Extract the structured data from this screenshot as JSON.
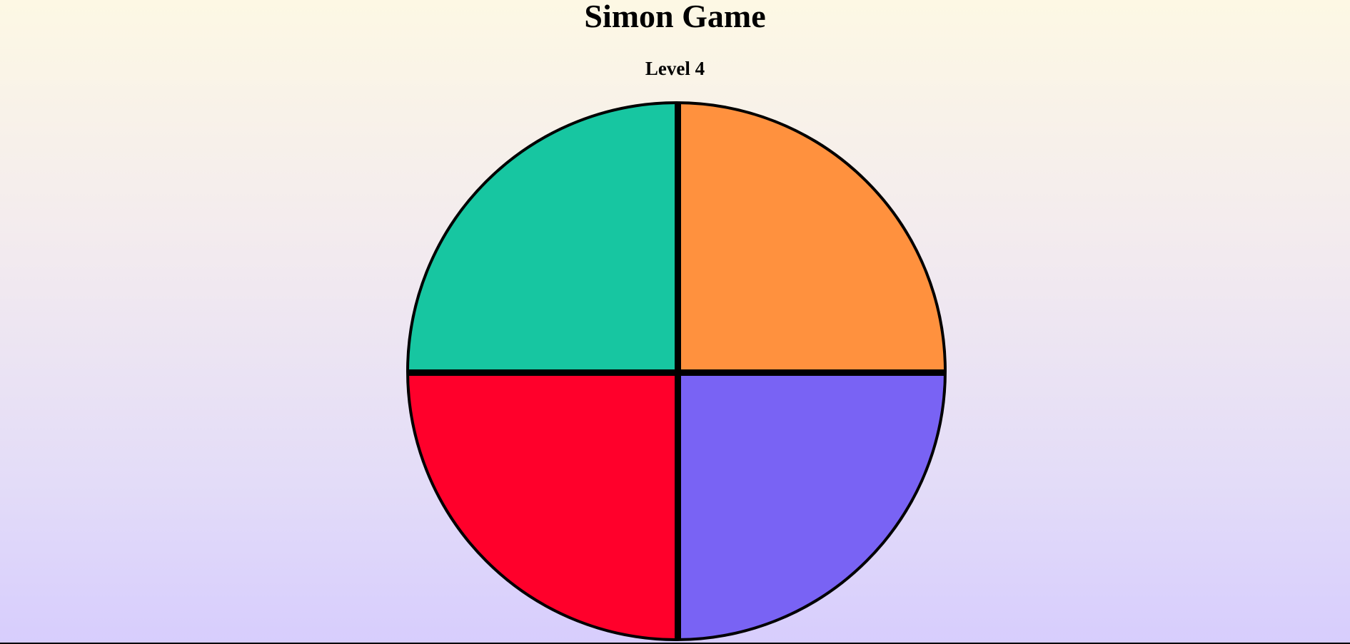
{
  "header": {
    "title": "Simon Game",
    "level": "Level 4"
  },
  "pads": [
    {
      "name": "green",
      "color": "#17c6a1"
    },
    {
      "name": "orange",
      "color": "#ff913e"
    },
    {
      "name": "red",
      "color": "#ff002b"
    },
    {
      "name": "purple",
      "color": "#7963f4"
    }
  ],
  "colors": {
    "background_top": "#fdf8e4",
    "background_bottom": "#d7cdfd",
    "divider": "#000000"
  }
}
